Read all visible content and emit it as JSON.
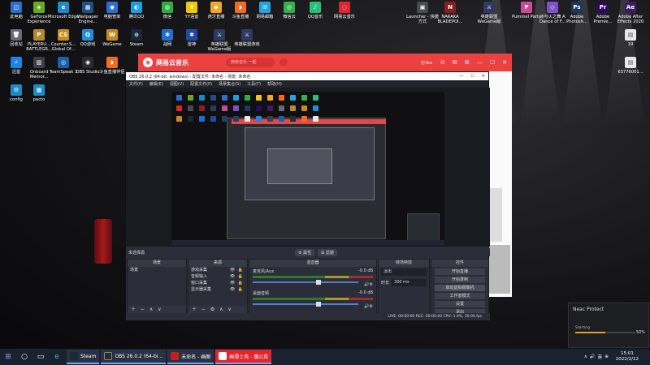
{
  "desktop_icons": [
    {
      "label": "此电脑",
      "color": "#2a6fd0",
      "glyph": "◫"
    },
    {
      "label": "GeForce Experience",
      "color": "#6aa820",
      "glyph": "◈"
    },
    {
      "label": "Microsoft Edge",
      "color": "#1e88c8",
      "glyph": "e"
    },
    {
      "label": "Wallpaper Engine...",
      "color": "#1f4f88",
      "glyph": "▦"
    },
    {
      "label": "电脑管家",
      "color": "#2b6ed0",
      "glyph": "◉"
    },
    {
      "label": "腾讯QQ",
      "color": "#1d9de4",
      "glyph": "◐"
    },
    {
      "label": "微信",
      "color": "#2eae41",
      "glyph": "◍"
    },
    {
      "label": "YY语音",
      "color": "#f1c70e",
      "glyph": "Y"
    },
    {
      "label": "虎牙直播",
      "color": "#f5a623",
      "glyph": "◆"
    },
    {
      "label": "斗鱼直播",
      "color": "#f26b1e",
      "glyph": "◗"
    },
    {
      "label": "网易邮箱",
      "color": "#22a4e0",
      "glyph": "✉"
    },
    {
      "label": "微信云",
      "color": "#2fb24a",
      "glyph": "◎"
    },
    {
      "label": "QQ音乐",
      "color": "#25c27a",
      "glyph": "♪"
    },
    {
      "label": "网易云音乐",
      "color": "#e0262c",
      "glyph": "◌"
    },
    {
      "label": "Launcher - 快捷方式",
      "color": "#4a4a52",
      "glyph": "▣"
    },
    {
      "label": "NARAKA BLADEPOI...",
      "color": "#8b1e23",
      "glyph": "N"
    },
    {
      "label": "英雄联盟 WeGame版",
      "color": "#2d3b63",
      "glyph": "⚔"
    },
    {
      "label": "Pummel Party",
      "color": "#c64c96",
      "glyph": "P"
    },
    {
      "label": "冰与火之舞 A Dance of F...",
      "color": "#7e51c7",
      "glyph": "◇"
    },
    {
      "label": "Adobe Photosh...",
      "color": "#1e3761",
      "glyph": "Ps"
    },
    {
      "label": "Adobe Premie...",
      "color": "#2d0a5c",
      "glyph": "Pr"
    },
    {
      "label": "Adobe After Effects 2020",
      "color": "#3a1b6e",
      "glyph": "Ae"
    },
    {
      "label": "回收站",
      "color": "#666a75",
      "glyph": "🗑"
    },
    {
      "label": "PLAYERU... BATTLEGR...",
      "color": "#b78a30",
      "glyph": "P"
    },
    {
      "label": "Counter-S... Global Of...",
      "color": "#c98d17",
      "glyph": "CS"
    },
    {
      "label": "QQ游戏",
      "color": "#1f8de0",
      "glyph": "Q"
    },
    {
      "label": "WeGame",
      "color": "#c78a20",
      "glyph": "W"
    },
    {
      "label": "Steam",
      "color": "#1b2838",
      "glyph": "⊙"
    },
    {
      "label": "战网",
      "color": "#1d6fd1",
      "glyph": "✱"
    },
    {
      "label": "雷神",
      "color": "#1e4aa5",
      "glyph": "✱"
    },
    {
      "label": "英雄联盟 WeGame版",
      "color": "#2d3b63",
      "glyph": "⚔"
    },
    {
      "label": "英雄联盟游戏",
      "color": "#2d3b63",
      "glyph": "⚔"
    },
    {
      "label": "19",
      "color": "#e8e8e8",
      "glyph": "▤"
    },
    {
      "label": "迅雷",
      "color": "#1b84e6",
      "glyph": "⚡"
    },
    {
      "label": "Onboard Memor...",
      "color": "#3e3e48",
      "glyph": "▥"
    },
    {
      "label": "TeamSpeak 3",
      "color": "#1e5fa8",
      "glyph": "◎"
    },
    {
      "label": "OBS Studio",
      "color": "#2b2b2b",
      "glyph": "◉"
    },
    {
      "label": "斗鱼直播伴侣",
      "color": "#f26b1e",
      "glyph": "◗"
    },
    {
      "label": "63776001...",
      "color": "#e8e8e8",
      "glyph": "▤"
    },
    {
      "label": "config",
      "color": "#1e88c8",
      "glyph": "⚙"
    },
    {
      "label": "pacto",
      "color": "#1e88c8",
      "glyph": "▦"
    }
  ],
  "netease": {
    "title": "网易云音乐",
    "search_placeholder": "搜索音乐 一起",
    "user": "打Yoo",
    "controls": [
      "⊙",
      "✉",
      "⚙",
      "—",
      "☐",
      "✕"
    ]
  },
  "obs": {
    "title": "OBS 26.0.2 (64-bit, windows) - 配置文件: 未命名 - 场景: 未命名",
    "window_controls": [
      "—",
      "☐",
      "✕"
    ],
    "menu": [
      "文件(F)",
      "编辑(E)",
      "视图(V)",
      "配置文件(P)",
      "场景集合(S)",
      "工具(T)",
      "帮助(H)"
    ],
    "source_bar": {
      "left": "未选择源",
      "props": "⚙ 属性",
      "filters": "⊞ 滤镜"
    },
    "docks": {
      "scenes": {
        "header": "场景",
        "items": [
          "场景"
        ],
        "footer": "＋ − ∧ ∨"
      },
      "sources": {
        "header": "来源",
        "items": [
          {
            "name": "游戏采集",
            "icons": "👁 🔒"
          },
          {
            "name": "音频输入",
            "icons": "👁 🔒"
          },
          {
            "name": "窗口采集",
            "icons": "👁 🔒"
          },
          {
            "name": "显示器采集",
            "icons": "👁 🔒"
          }
        ],
        "footer": "＋ − ⚙ ∧ ∨"
      },
      "mixer": {
        "header": "混音器",
        "channels": [
          {
            "name": "麦克风/Aux",
            "db": "-0.0 dB"
          },
          {
            "name": "桌面音频",
            "db": "-0.0 dB"
          }
        ]
      },
      "transitions": {
        "header": "转场特效",
        "type": "淡出",
        "duration_label": "时长",
        "duration": "300 ms"
      },
      "controls": {
        "header": "控件",
        "buttons": [
          "开始直播",
          "开始录制",
          "启动虚拟摄像机",
          "工作室模式",
          "设置",
          "退出"
        ]
      }
    },
    "status": "LIVE: 00:00:00    REC: 00:00:00    CPU: 1.9%, 30.00 fps"
  },
  "neac": {
    "title": "Neac Protect",
    "status": "Starting",
    "percent": "50%",
    "progress": 0.5
  },
  "taskbar": {
    "start_glyph": "⊞",
    "quick": [
      {
        "name": "search",
        "glyph": "○"
      },
      {
        "name": "task-view",
        "glyph": "▭"
      },
      {
        "name": "edge",
        "glyph": "e"
      }
    ],
    "apps": [
      {
        "label": "Steam",
        "color": "#1b2838"
      },
      {
        "label": "OBS 26.0.2 (64-bi...",
        "color": "#2b2b2b"
      },
      {
        "label": "未命名 - 画图",
        "color": "#c2221c"
      },
      {
        "label": "画薄土壳 - 蒲公英",
        "color": "#e0262c"
      }
    ],
    "tray": [
      "∧",
      "🔊",
      "英",
      "⊕"
    ],
    "time": "15:01",
    "date": "2022/2/12"
  }
}
